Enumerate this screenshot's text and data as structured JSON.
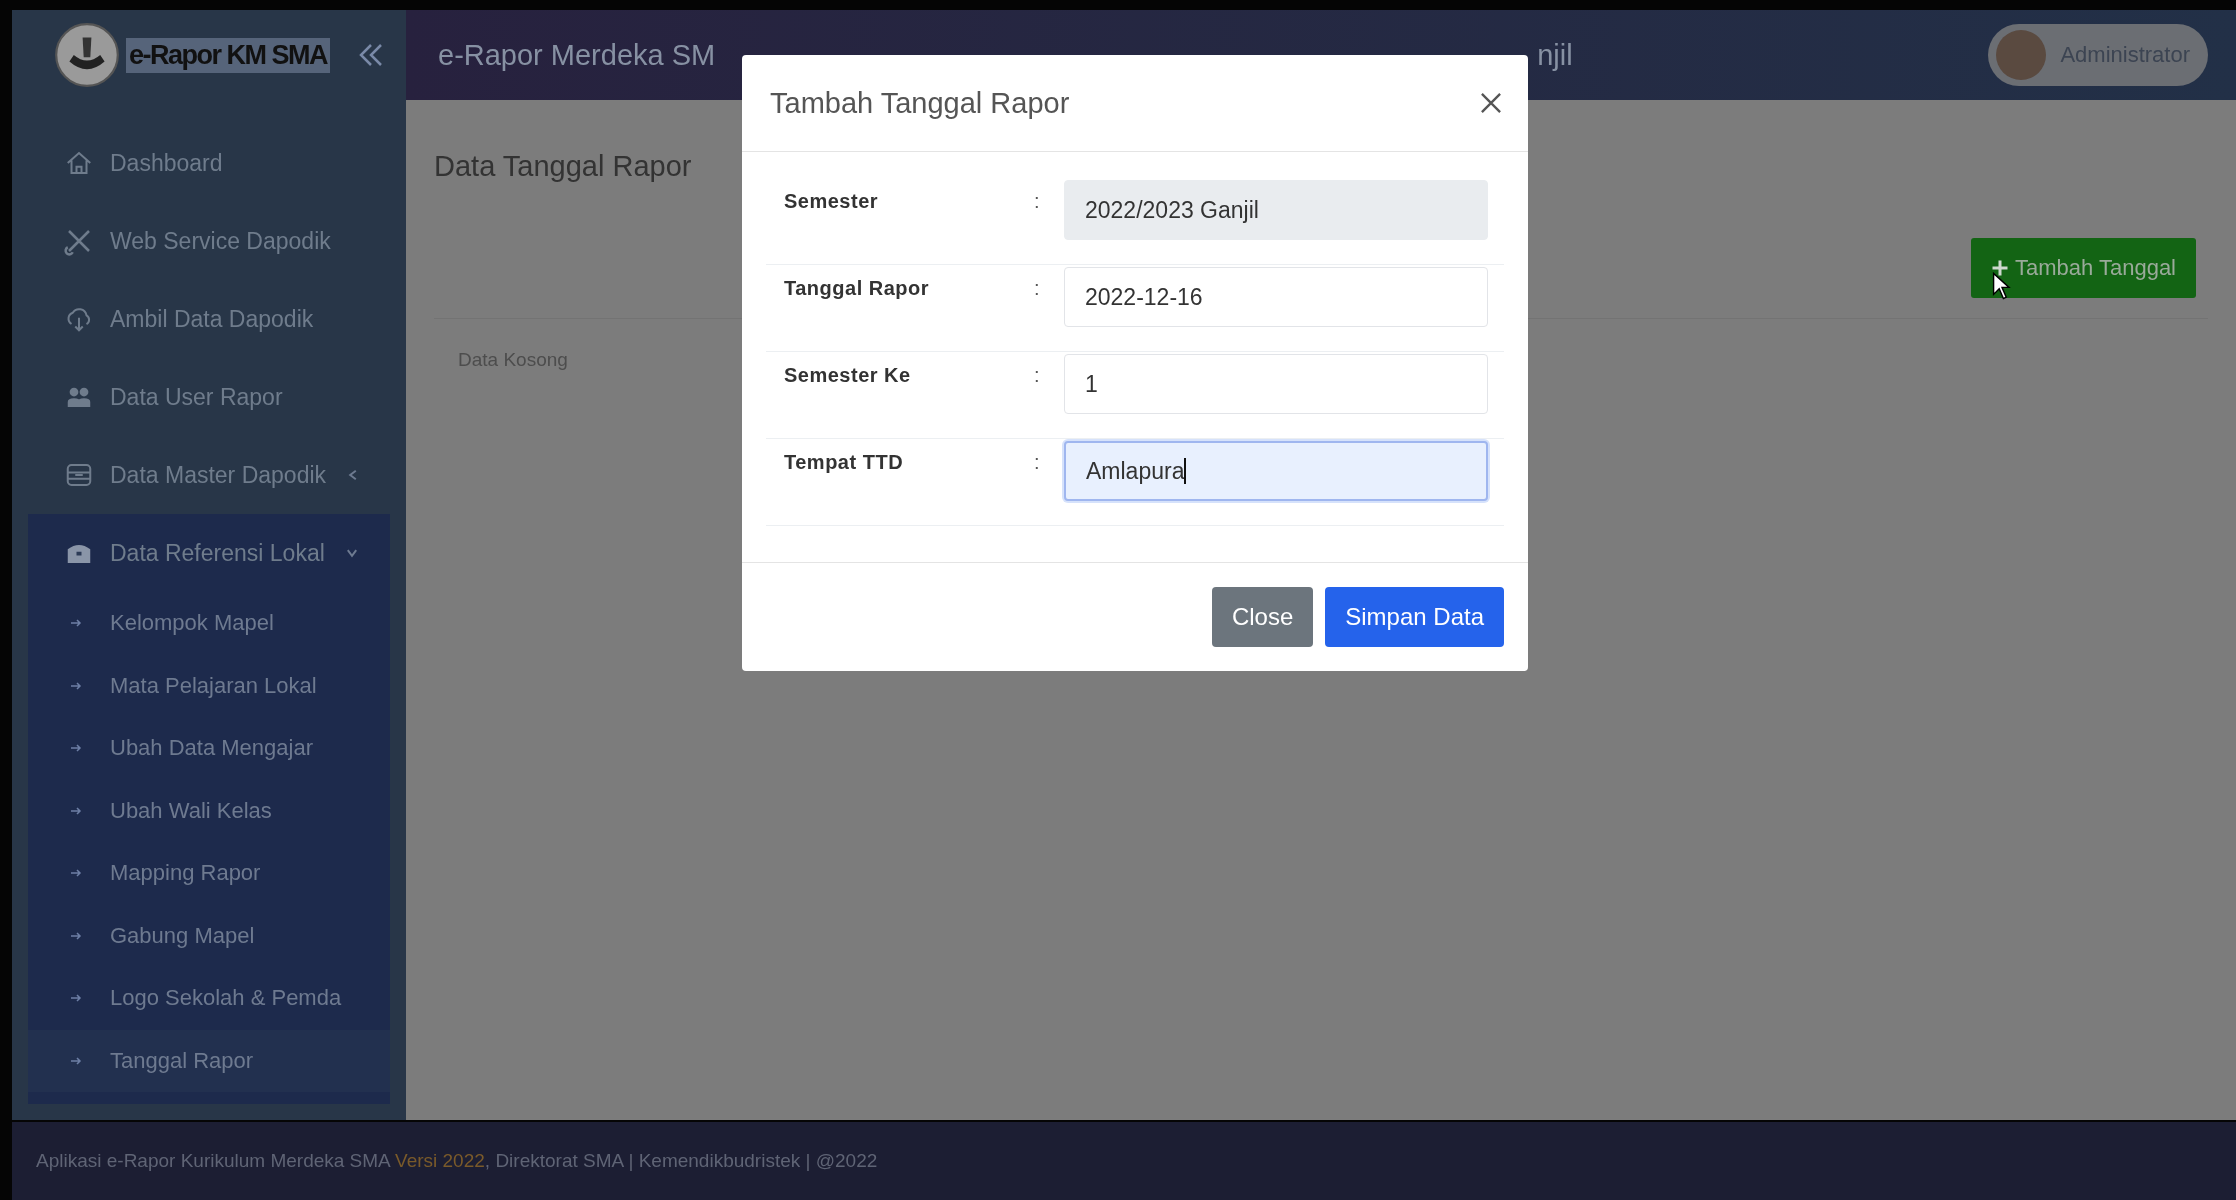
{
  "header": {
    "app_name": "e-Rapor KM SMA",
    "title_start": "e-Rapor Merdeka SM",
    "title_end": "njil",
    "user": "Administrator"
  },
  "sidebar": {
    "items": [
      {
        "label": "Dashboard"
      },
      {
        "label": "Web Service Dapodik"
      },
      {
        "label": "Ambil Data Dapodik"
      },
      {
        "label": "Data User Rapor"
      },
      {
        "label": "Data Master Dapodik",
        "expanded": false
      },
      {
        "label": "Data Referensi Lokal",
        "expanded": true,
        "children": [
          {
            "label": "Kelompok Mapel",
            "selected": false
          },
          {
            "label": "Mata Pelajaran Lokal",
            "selected": false
          },
          {
            "label": "Ubah Data Mengajar",
            "selected": false
          },
          {
            "label": "Ubah Wali Kelas",
            "selected": false
          },
          {
            "label": "Mapping Rapor",
            "selected": false
          },
          {
            "label": "Gabung Mapel",
            "selected": false
          },
          {
            "label": "Logo Sekolah & Pemda",
            "selected": false
          },
          {
            "label": "Tanggal Rapor",
            "selected": true
          }
        ]
      }
    ]
  },
  "page": {
    "title": "Data Tanggal Rapor",
    "add_button": "Tambah Tanggal",
    "empty_text": "Data Kosong"
  },
  "modal": {
    "title": "Tambah Tanggal Rapor",
    "fields": [
      {
        "label": "Semester",
        "separator": ":",
        "value": "2022/2023 Ganjil",
        "disabled": true,
        "focused": false
      },
      {
        "label": "Tanggal Rapor",
        "separator": ":",
        "value": "2022-12-16",
        "disabled": false,
        "focused": false
      },
      {
        "label": "Semester Ke",
        "separator": ":",
        "value": "1",
        "disabled": false,
        "focused": false
      },
      {
        "label": "Tempat TTD",
        "separator": ":",
        "value": "Amlapura",
        "disabled": false,
        "focused": true
      }
    ],
    "buttons": [
      {
        "label": "Close",
        "kind": "secondary"
      },
      {
        "label": "Simpan Data",
        "kind": "primary"
      }
    ]
  },
  "footer": {
    "parts": [
      {
        "text": "Aplikasi e-Rapor Kurikulum Merdeka SMA ",
        "highlight": false
      },
      {
        "text": "Versi 2022",
        "highlight": true
      },
      {
        "text": ", Direktorat SMA | Kemendikbudristek | @2022",
        "highlight": false
      }
    ]
  }
}
